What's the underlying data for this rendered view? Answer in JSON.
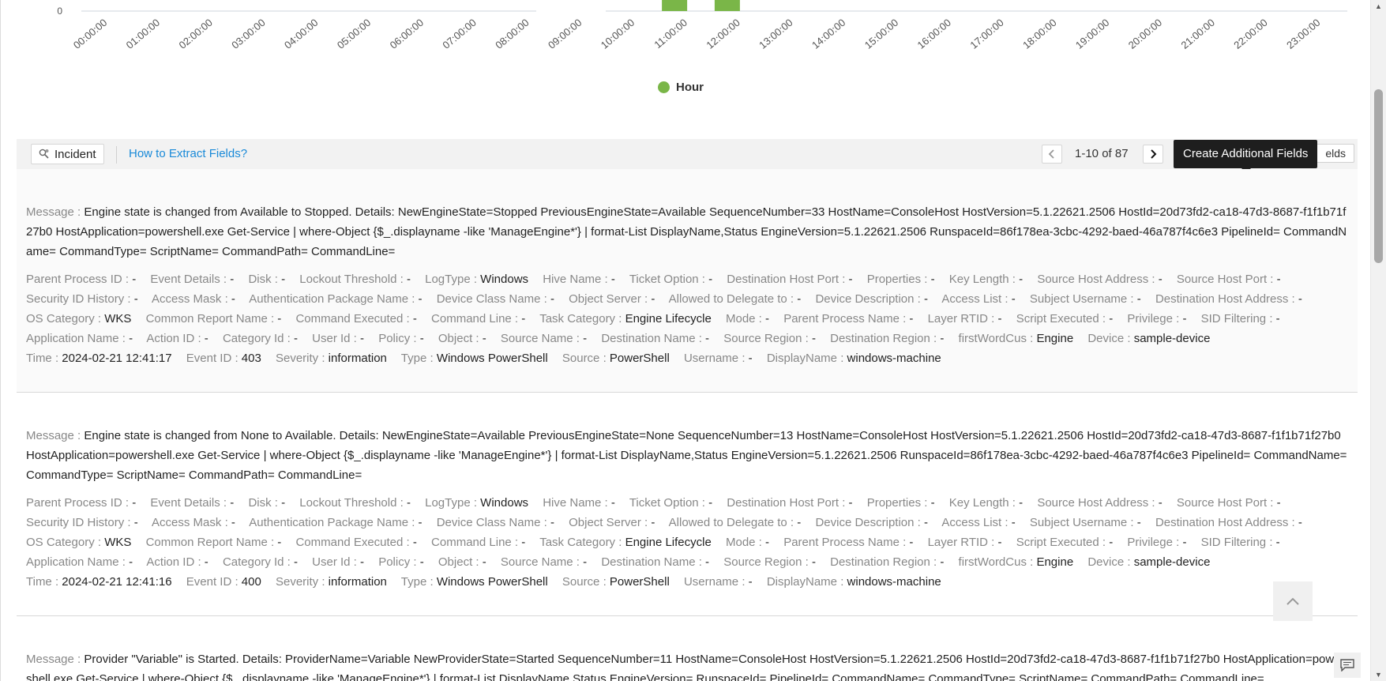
{
  "chart_data": {
    "type": "bar",
    "categories": [
      "00:00:00",
      "01:00:00",
      "02:00:00",
      "03:00:00",
      "04:00:00",
      "05:00:00",
      "06:00:00",
      "07:00:00",
      "08:00:00",
      "09:00:00",
      "10:00:00",
      "11:00:00",
      "12:00:00",
      "13:00:00",
      "14:00:00",
      "15:00:00",
      "16:00:00",
      "17:00:00",
      "18:00:00",
      "19:00:00",
      "20:00:00",
      "21:00:00",
      "22:00:00",
      "23:00:00"
    ],
    "series": [
      {
        "name": "Hour",
        "color": "#7ab648",
        "values": [
          0,
          0,
          0,
          0,
          0,
          0,
          0,
          0,
          0,
          0,
          0,
          null,
          null,
          0,
          0,
          0,
          0,
          0,
          0,
          0,
          0,
          0,
          0,
          0
        ]
      }
    ],
    "y_tick_visible": "0",
    "legend": "bottom"
  },
  "legend_label": "Hour",
  "toolbar": {
    "incident_label": "Incident",
    "extract_link": "How to Extract Fields?",
    "page_range": "1-10 of 87",
    "fields_button_partial": "elds",
    "tooltip": "Create Additional Fields",
    "prev_icon": "chevron-left-icon",
    "next_icon": "chevron-right-icon"
  },
  "action_icons": [
    "edit-fields-icon",
    "tag-icon",
    "search-document-icon"
  ],
  "events": [
    {
      "message_label": "Message",
      "message": "Engine state is changed from Available to Stopped. Details: NewEngineState=Stopped PreviousEngineState=Available SequenceNumber=33 HostName=ConsoleHost HostVersion=5.1.22621.2506 HostId=20d73fd2-ca18-47d3-8687-f1f1b71f27b0 HostApplication=powershell.exe Get-Service | where-Object {$_.displayname -like 'ManageEngine*'} | format-List DisplayName,Status EngineVersion=5.1.22621.2506 RunspaceId=86f178ea-3cbc-4292-baed-46a787f4c6e3 PipelineId= CommandName= CommandType= ScriptName= CommandPath= CommandLine=",
      "fields": [
        {
          "label": "Parent Process ID",
          "value": "-"
        },
        {
          "label": "Event Details",
          "value": "-"
        },
        {
          "label": "Disk",
          "value": "-"
        },
        {
          "label": "Lockout Threshold",
          "value": "-"
        },
        {
          "label": "LogType",
          "value": "Windows"
        },
        {
          "label": "Hive Name",
          "value": "-"
        },
        {
          "label": "Ticket Option",
          "value": "-"
        },
        {
          "label": "Destination Host Port",
          "value": "-"
        },
        {
          "label": "Properties",
          "value": "-"
        },
        {
          "label": "Key Length",
          "value": "-"
        },
        {
          "label": "Source Host Address",
          "value": "-"
        },
        {
          "label": "Source Host Port",
          "value": "-"
        },
        {
          "label": "Security ID History",
          "value": "-"
        },
        {
          "label": "Access Mask",
          "value": "-"
        },
        {
          "label": "Authentication Package Name",
          "value": "-"
        },
        {
          "label": "Device Class Name",
          "value": "-"
        },
        {
          "label": "Object Server",
          "value": "-"
        },
        {
          "label": "Allowed to Delegate to",
          "value": "-"
        },
        {
          "label": "Device Description",
          "value": "-"
        },
        {
          "label": "Access List",
          "value": "-"
        },
        {
          "label": "Subject Username",
          "value": "-"
        },
        {
          "label": "Destination Host Address",
          "value": "-"
        },
        {
          "label": "OS Category",
          "value": "WKS"
        },
        {
          "label": "Common Report Name",
          "value": "-"
        },
        {
          "label": "Command Executed",
          "value": "-"
        },
        {
          "label": "Command Line",
          "value": "-"
        },
        {
          "label": "Task Category",
          "value": "Engine Lifecycle"
        },
        {
          "label": "Mode",
          "value": "-"
        },
        {
          "label": "Parent Process Name",
          "value": "-"
        },
        {
          "label": "Layer RTID",
          "value": "-"
        },
        {
          "label": "Script Executed",
          "value": "-"
        },
        {
          "label": "Privilege",
          "value": "-"
        },
        {
          "label": "SID Filtering",
          "value": "-"
        },
        {
          "label": "Application Name",
          "value": "-"
        },
        {
          "label": "Action ID",
          "value": "-"
        },
        {
          "label": "Category Id",
          "value": "-"
        },
        {
          "label": "User Id",
          "value": "-"
        },
        {
          "label": "Policy",
          "value": "-"
        },
        {
          "label": "Object",
          "value": "-"
        },
        {
          "label": "Source Name",
          "value": "-"
        },
        {
          "label": "Destination Name",
          "value": "-"
        },
        {
          "label": "Source Region",
          "value": "-"
        },
        {
          "label": "Destination Region",
          "value": "-"
        },
        {
          "label": "firstWordCus",
          "value": "Engine"
        },
        {
          "label": "Device",
          "value": "sample-device"
        },
        {
          "label": "Time",
          "value": "2024-02-21 12:41:17"
        },
        {
          "label": "Event ID",
          "value": "403"
        },
        {
          "label": "Severity",
          "value": "information"
        },
        {
          "label": "Type",
          "value": "Windows PowerShell"
        },
        {
          "label": "Source",
          "value": "PowerShell"
        },
        {
          "label": "Username",
          "value": "-"
        },
        {
          "label": "DisplayName",
          "value": "windows-machine"
        }
      ]
    },
    {
      "message_label": "Message",
      "message": "Engine state is changed from None to Available. Details: NewEngineState=Available PreviousEngineState=None SequenceNumber=13 HostName=ConsoleHost HostVersion=5.1.22621.2506 HostId=20d73fd2-ca18-47d3-8687-f1f1b71f27b0 HostApplication=powershell.exe Get-Service | where-Object {$_.displayname -like 'ManageEngine*'} | format-List DisplayName,Status EngineVersion=5.1.22621.2506 RunspaceId=86f178ea-3cbc-4292-baed-46a787f4c6e3 PipelineId= CommandName= CommandType= ScriptName= CommandPath= CommandLine=",
      "fields": [
        {
          "label": "Parent Process ID",
          "value": "-"
        },
        {
          "label": "Event Details",
          "value": "-"
        },
        {
          "label": "Disk",
          "value": "-"
        },
        {
          "label": "Lockout Threshold",
          "value": "-"
        },
        {
          "label": "LogType",
          "value": "Windows"
        },
        {
          "label": "Hive Name",
          "value": "-"
        },
        {
          "label": "Ticket Option",
          "value": "-"
        },
        {
          "label": "Destination Host Port",
          "value": "-"
        },
        {
          "label": "Properties",
          "value": "-"
        },
        {
          "label": "Key Length",
          "value": "-"
        },
        {
          "label": "Source Host Address",
          "value": "-"
        },
        {
          "label": "Source Host Port",
          "value": "-"
        },
        {
          "label": "Security ID History",
          "value": "-"
        },
        {
          "label": "Access Mask",
          "value": "-"
        },
        {
          "label": "Authentication Package Name",
          "value": "-"
        },
        {
          "label": "Device Class Name",
          "value": "-"
        },
        {
          "label": "Object Server",
          "value": "-"
        },
        {
          "label": "Allowed to Delegate to",
          "value": "-"
        },
        {
          "label": "Device Description",
          "value": "-"
        },
        {
          "label": "Access List",
          "value": "-"
        },
        {
          "label": "Subject Username",
          "value": "-"
        },
        {
          "label": "Destination Host Address",
          "value": "-"
        },
        {
          "label": "OS Category",
          "value": "WKS"
        },
        {
          "label": "Common Report Name",
          "value": "-"
        },
        {
          "label": "Command Executed",
          "value": "-"
        },
        {
          "label": "Command Line",
          "value": "-"
        },
        {
          "label": "Task Category",
          "value": "Engine Lifecycle"
        },
        {
          "label": "Mode",
          "value": "-"
        },
        {
          "label": "Parent Process Name",
          "value": "-"
        },
        {
          "label": "Layer RTID",
          "value": "-"
        },
        {
          "label": "Script Executed",
          "value": "-"
        },
        {
          "label": "Privilege",
          "value": "-"
        },
        {
          "label": "SID Filtering",
          "value": "-"
        },
        {
          "label": "Application Name",
          "value": "-"
        },
        {
          "label": "Action ID",
          "value": "-"
        },
        {
          "label": "Category Id",
          "value": "-"
        },
        {
          "label": "User Id",
          "value": "-"
        },
        {
          "label": "Policy",
          "value": "-"
        },
        {
          "label": "Object",
          "value": "-"
        },
        {
          "label": "Source Name",
          "value": "-"
        },
        {
          "label": "Destination Name",
          "value": "-"
        },
        {
          "label": "Source Region",
          "value": "-"
        },
        {
          "label": "Destination Region",
          "value": "-"
        },
        {
          "label": "firstWordCus",
          "value": "Engine"
        },
        {
          "label": "Device",
          "value": "sample-device"
        },
        {
          "label": "Time",
          "value": "2024-02-21 12:41:16"
        },
        {
          "label": "Event ID",
          "value": "400"
        },
        {
          "label": "Severity",
          "value": "information"
        },
        {
          "label": "Type",
          "value": "Windows PowerShell"
        },
        {
          "label": "Source",
          "value": "PowerShell"
        },
        {
          "label": "Username",
          "value": "-"
        },
        {
          "label": "DisplayName",
          "value": "windows-machine"
        }
      ]
    },
    {
      "message_label": "Message",
      "message": "Provider \"Variable\" is Started. Details: ProviderName=Variable NewProviderState=Started SequenceNumber=11 HostName=ConsoleHost HostVersion=5.1.22621.2506 HostId=20d73fd2-ca18-47d3-8687-f1f1b71f27b0 HostApplication=powershell.exe Get-Service | where-Object {$_.displayname -like 'ManageEngine*'} | format-List DisplayName,Status EngineVersion= RunspaceId= PipelineId= CommandName= CommandType= ScriptName= CommandPath= CommandLine=",
      "fields": []
    }
  ]
}
